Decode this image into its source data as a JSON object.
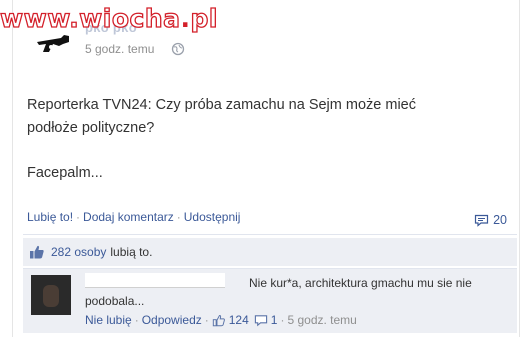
{
  "watermark": {
    "text": "www.wiocha",
    "dot": ".",
    "tld": "pl"
  },
  "post": {
    "author": "pko pko",
    "time": "5 godz. temu",
    "lines": [
      "Reporterka TVN24: Czy próba zamachu na Sejm może mieć",
      "podłoże polityczne?"
    ],
    "second_paragraph": "Facepalm..."
  },
  "actions": {
    "like": "Lubię to!",
    "comment": "Dodaj komentarz",
    "share": "Udostępnij",
    "comment_count": "20"
  },
  "likes": {
    "count_text": "282 osoby",
    "suffix": "lubią to."
  },
  "comment": {
    "text": "Nie kur*a, architektura gmachu mu sie nie podobala...",
    "unlike": "Nie lubię",
    "reply": "Odpowiedz",
    "likes": "124",
    "replies": "1",
    "time": "5 godz. temu"
  },
  "icons": {
    "globe": "globe-icon",
    "comment": "comment-bubble-icon",
    "thumb": "thumbs-up-icon"
  },
  "colors": {
    "link": "#3b5998",
    "meta": "#8f8f8f",
    "watermark": "#d3202a",
    "panel": "#edeff4"
  }
}
